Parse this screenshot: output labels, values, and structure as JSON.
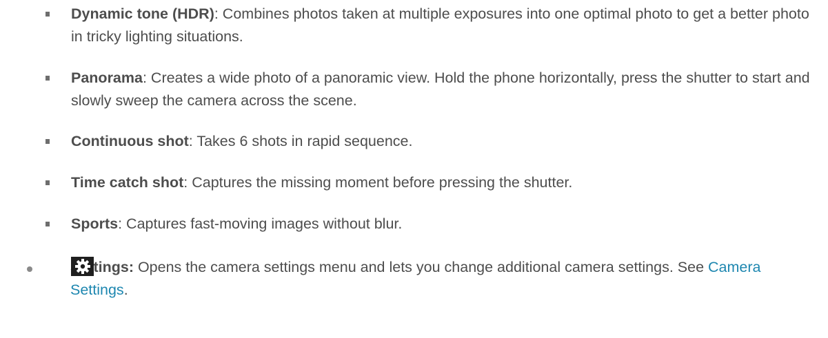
{
  "modes": [
    {
      "term": "Dynamic tone (HDR)",
      "desc": ": Combines photos taken at multiple exposures into one optimal photo to get a better photo in tricky lighting situations."
    },
    {
      "term": "Panorama",
      "desc": ": Creates a wide photo of a panoramic view. Hold the phone horizontally, press the shutter to start and slowly sweep the camera across the scene."
    },
    {
      "term": "Continuous shot",
      "desc": ": Takes 6 shots in rapid sequence."
    },
    {
      "term": "Time catch shot",
      "desc": ": Captures the missing moment before pressing the shutter."
    },
    {
      "term": "Sports",
      "desc": ": Captures fast-moving images without blur."
    }
  ],
  "settings": {
    "icon": "gear-icon",
    "term": "Settings:",
    "desc": " Opens the camera settings menu and lets you change additional camera settings. See ",
    "link_text": "Camera Settings",
    "suffix": "."
  },
  "colors": {
    "text": "#4d4d4d",
    "link": "#1e87b0",
    "icon_bg": "#1f1f1f"
  }
}
